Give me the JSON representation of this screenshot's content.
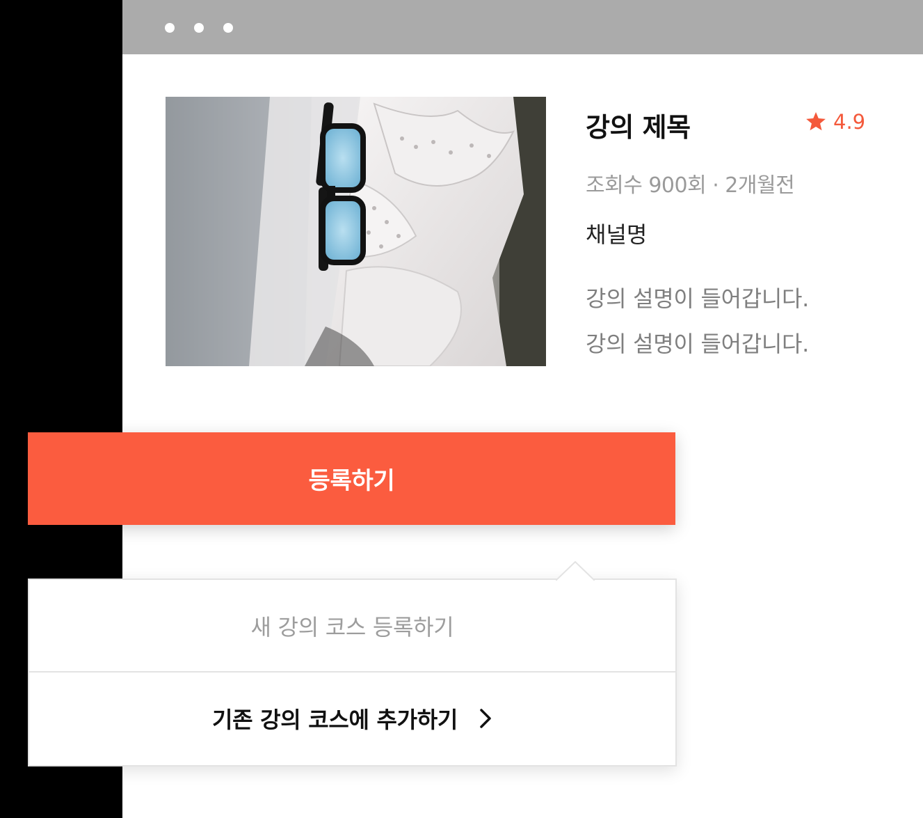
{
  "window": {
    "dots": [
      "window-dot-1",
      "window-dot-2",
      "window-dot-3"
    ]
  },
  "lecture": {
    "title": "강의 제목",
    "rating": "4.9",
    "rating_icon": "star-icon",
    "meta": "조회수 900회 · 2개월전",
    "channel": "채널명",
    "description_lines": [
      "강의 설명이 들어갑니다.",
      "강의 설명이 들어갑니다."
    ],
    "thumbnail_icon": "sunglasses-on-white-shirt-photo"
  },
  "actions": {
    "register_label": "등록하기",
    "menu": {
      "new_course_label": "새 강의 코스 등록하기",
      "existing_course_label": "기존 강의 코스에 추가하기",
      "existing_course_icon": "chevron-right-icon"
    }
  },
  "colors": {
    "accent": "#fb5c3f",
    "rating": "#f4593b",
    "titlebar": "#ababab",
    "muted_text": "#9a9a9a"
  }
}
